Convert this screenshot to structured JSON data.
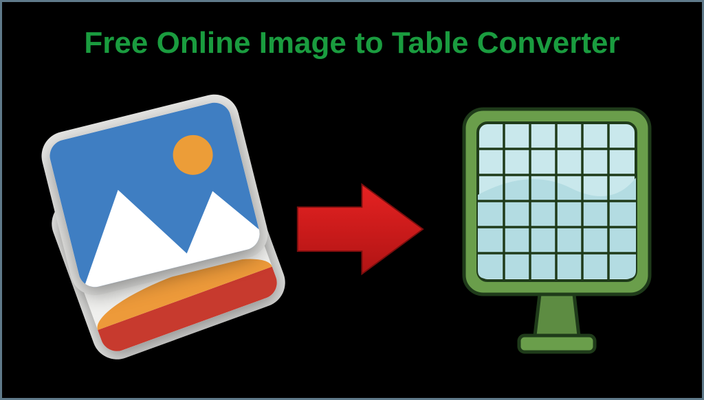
{
  "title": "Free Online Image to Table Converter",
  "icons": {
    "left": "photo-stack-icon",
    "middle": "arrow-right-icon",
    "right": "table-monitor-icon"
  },
  "colors": {
    "title": "#1a9c3f",
    "arrow": "#d91a1a",
    "monitor_frame": "#6a9e4b",
    "monitor_screen": "#c9e8ec"
  }
}
